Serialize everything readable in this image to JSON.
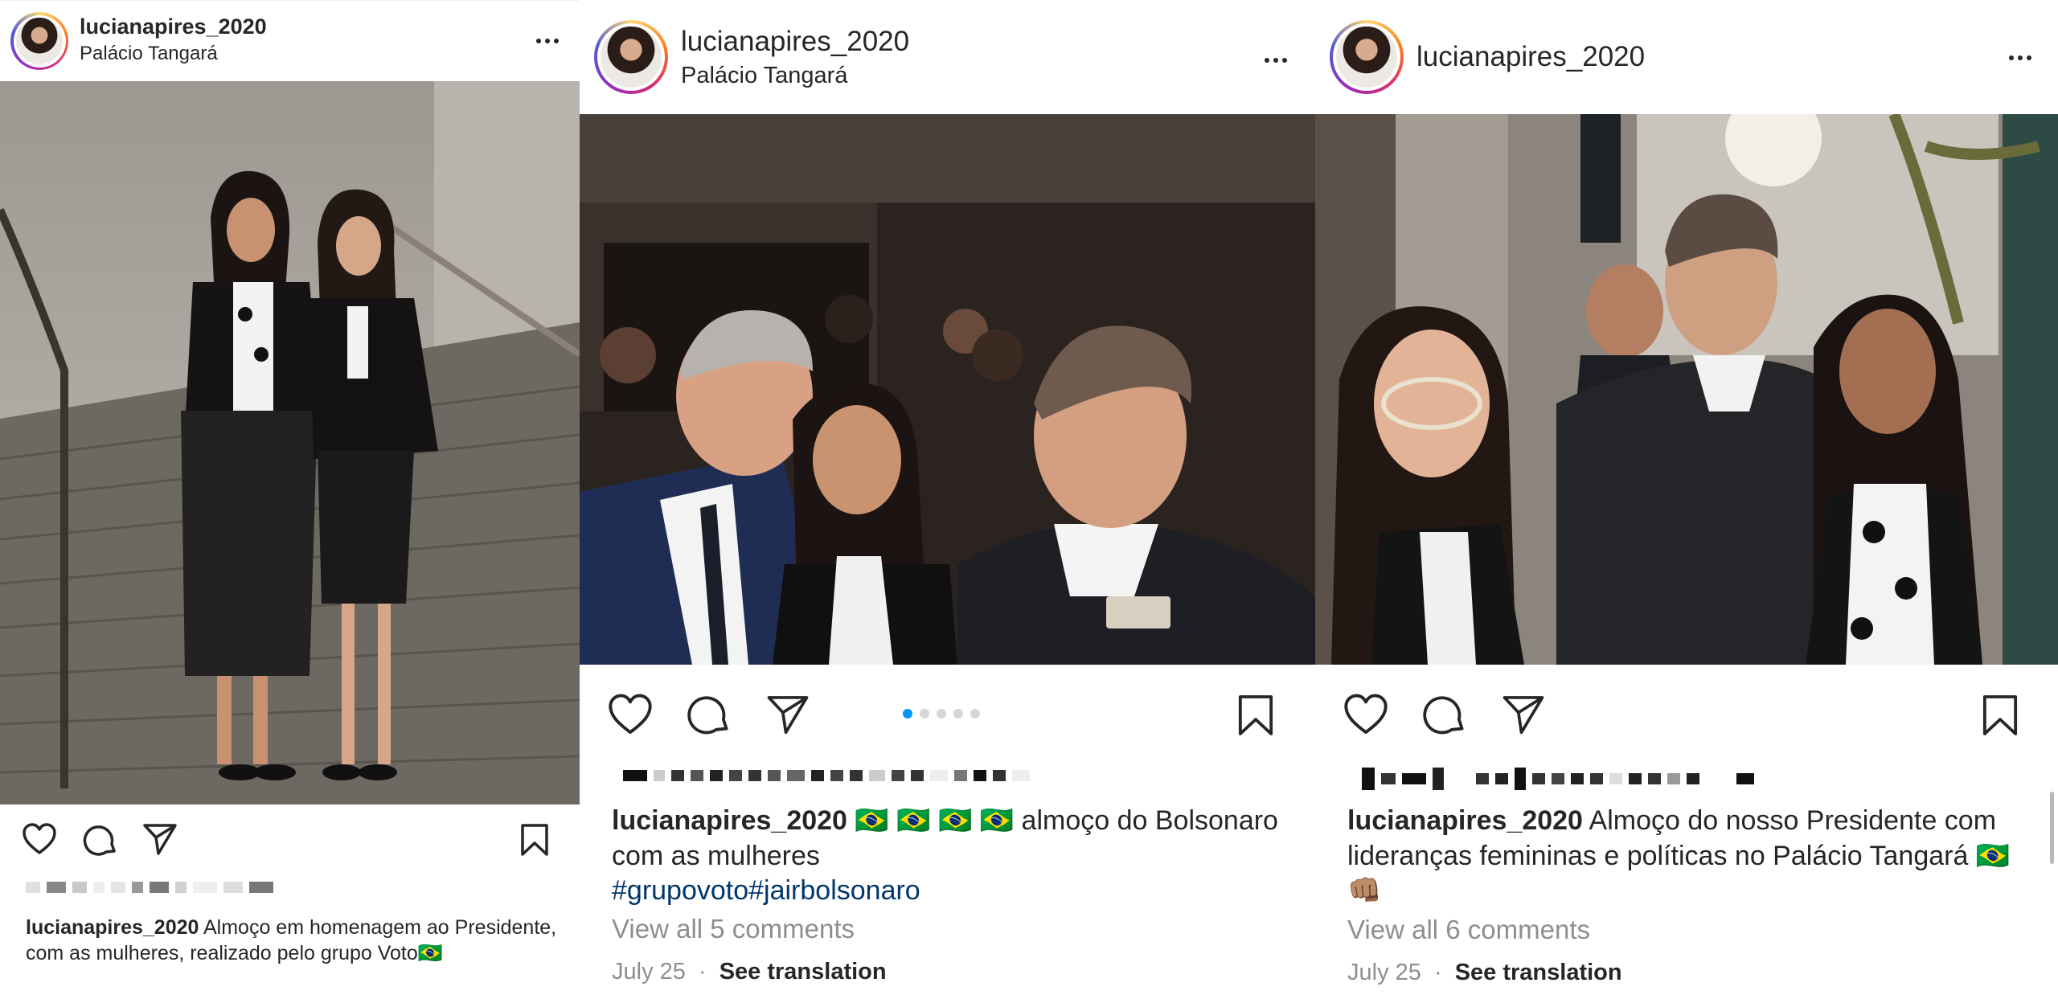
{
  "posts": [
    {
      "username": "lucianapires_2020",
      "location": "Palácio Tangará",
      "caption_user": "lucianapires_2020",
      "caption_text": "Almoço em homenagem ao Presidente, com as mulheres, realizado pelo grupo Voto🇧🇷",
      "photo_description_icon": "photo-two-women-on-staircase"
    },
    {
      "username": "lucianapires_2020",
      "location": "Palácio Tangará",
      "caption_user": "lucianapires_2020",
      "caption_text": "🇧🇷 🇧🇷 🇧🇷 🇧🇷 almoço do Bolsonaro com as mulheres",
      "hashtags": "#grupovoto#jairbolsonaro",
      "view_all": "View all 5 comments",
      "date": "July 25",
      "separator": "·",
      "translate": "See translation",
      "carousel": {
        "count": 5,
        "active": 1
      }
    },
    {
      "username": "lucianapires_2020",
      "caption_user": "lucianapires_2020",
      "caption_text": "Almoço do nosso Presidente com lideranças femininas e políticas no Palácio Tangará 🇧🇷 👊🏽",
      "view_all": "View all 6 comments",
      "date": "July 25",
      "separator": "·",
      "translate": "See translation"
    }
  ],
  "icons": {
    "more": "more-options-icon",
    "like": "heart-icon",
    "comment": "comment-bubble-icon",
    "share": "paper-plane-icon",
    "save": "bookmark-icon"
  },
  "colors": {
    "text": "#262626",
    "muted": "#8e8e8e",
    "hashtag": "#00376b",
    "carousel_active": "#0095f6"
  }
}
